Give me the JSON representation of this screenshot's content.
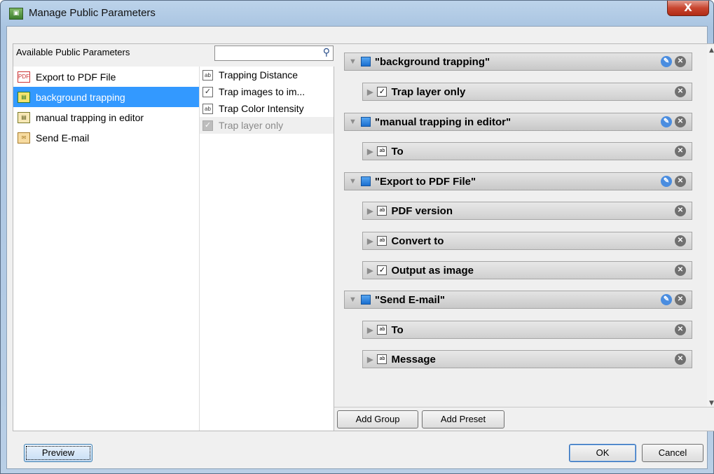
{
  "window": {
    "title": "Manage Public Parameters",
    "close_glyph": "X"
  },
  "left": {
    "header_label": "Available Public Parameters",
    "search": {
      "value": "",
      "placeholder": ""
    },
    "templates": [
      {
        "label": "Export to PDF File",
        "icon": "pdf-icon"
      },
      {
        "label": "background trapping",
        "icon": "workflow-icon",
        "selected": true
      },
      {
        "label": "manual trapping in editor",
        "icon": "workflow-icon"
      },
      {
        "label": "Send E-mail",
        "icon": "mail-icon"
      }
    ],
    "params": [
      {
        "label": "Trapping Distance",
        "type": "text"
      },
      {
        "label": "Trap images to im...",
        "type": "checkbox"
      },
      {
        "label": "Trap Color Intensity",
        "type": "text"
      },
      {
        "label": "Trap layer only",
        "type": "checkbox",
        "disabled": true
      }
    ]
  },
  "right": {
    "groups": [
      {
        "label": "\"background trapping\"",
        "params": [
          {
            "label": "Trap layer only",
            "type": "checkbox"
          }
        ]
      },
      {
        "label": "\"manual trapping in editor\"",
        "params": [
          {
            "label": "To",
            "type": "text"
          }
        ]
      },
      {
        "label": "\"Export to PDF File\"",
        "params": [
          {
            "label": "PDF version",
            "type": "text"
          },
          {
            "label": "Convert to",
            "type": "text"
          },
          {
            "label": "Output as image",
            "type": "checkbox"
          }
        ]
      },
      {
        "label": "\"Send E-mail\"",
        "params": [
          {
            "label": "To",
            "type": "text"
          },
          {
            "label": "Message",
            "type": "text"
          }
        ]
      }
    ],
    "add_group_label": "Add Group",
    "add_preset_label": "Add Preset"
  },
  "footer": {
    "preview_label": "Preview",
    "ok_label": "OK",
    "cancel_label": "Cancel"
  },
  "icon_glyphs": {
    "text_field": "ab",
    "checkbox": "✓"
  }
}
